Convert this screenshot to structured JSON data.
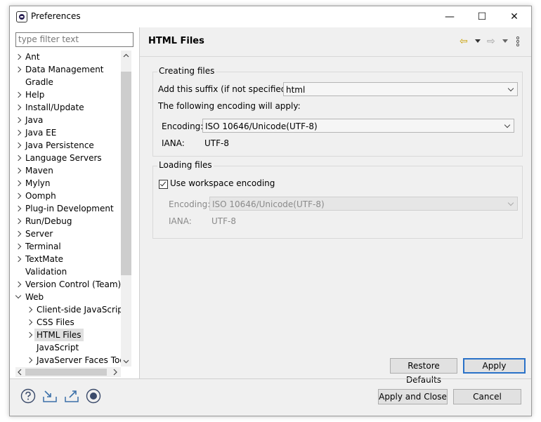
{
  "window": {
    "title": "Preferences",
    "minimize": "—",
    "maximize": "☐",
    "close": "✕"
  },
  "filter": {
    "placeholder": "type filter text"
  },
  "tree": [
    {
      "label": "Ant",
      "arrow": "right",
      "indent": 0
    },
    {
      "label": "Data Management",
      "arrow": "right",
      "indent": 0
    },
    {
      "label": "Gradle",
      "arrow": "none",
      "indent": 0
    },
    {
      "label": "Help",
      "arrow": "right",
      "indent": 0
    },
    {
      "label": "Install/Update",
      "arrow": "right",
      "indent": 0
    },
    {
      "label": "Java",
      "arrow": "right",
      "indent": 0
    },
    {
      "label": "Java EE",
      "arrow": "right",
      "indent": 0
    },
    {
      "label": "Java Persistence",
      "arrow": "right",
      "indent": 0
    },
    {
      "label": "Language Servers",
      "arrow": "right",
      "indent": 0
    },
    {
      "label": "Maven",
      "arrow": "right",
      "indent": 0
    },
    {
      "label": "Mylyn",
      "arrow": "right",
      "indent": 0
    },
    {
      "label": "Oomph",
      "arrow": "right",
      "indent": 0
    },
    {
      "label": "Plug-in Development",
      "arrow": "right",
      "indent": 0
    },
    {
      "label": "Run/Debug",
      "arrow": "right",
      "indent": 0
    },
    {
      "label": "Server",
      "arrow": "right",
      "indent": 0
    },
    {
      "label": "Terminal",
      "arrow": "right",
      "indent": 0
    },
    {
      "label": "TextMate",
      "arrow": "right",
      "indent": 0
    },
    {
      "label": "Validation",
      "arrow": "none",
      "indent": 0
    },
    {
      "label": "Version Control (Team)",
      "arrow": "right",
      "indent": 0
    },
    {
      "label": "Web",
      "arrow": "down",
      "indent": 0
    },
    {
      "label": "Client-side JavaScript",
      "arrow": "right",
      "indent": 1
    },
    {
      "label": "CSS Files",
      "arrow": "right",
      "indent": 1
    },
    {
      "label": "HTML Files",
      "arrow": "right",
      "indent": 1,
      "selected": true
    },
    {
      "label": "JavaScript",
      "arrow": "none",
      "indent": 1
    },
    {
      "label": "JavaServer Faces Tools",
      "arrow": "right",
      "indent": 1
    }
  ],
  "page": {
    "title": "HTML Files",
    "back_icon": "⇦",
    "forward_icon": "⇨",
    "creating": {
      "group_title": "Creating files",
      "suffix_label": "Add this suffix (if not specified):",
      "suffix_value": "html",
      "encoding_intro": "The following encoding will apply:",
      "encoding_label": "Encoding:",
      "encoding_value": "ISO 10646/Unicode(UTF-8)",
      "iana_label": "IANA:",
      "iana_value": "UTF-8"
    },
    "loading": {
      "group_title": "Loading files",
      "use_workspace_label": "Use workspace encoding",
      "use_workspace_checked": true,
      "encoding_label": "Encoding:",
      "encoding_value": "ISO 10646/Unicode(UTF-8)",
      "iana_label": "IANA:",
      "iana_value": "UTF-8"
    },
    "restore_defaults": "Restore Defaults",
    "apply": "Apply"
  },
  "footer": {
    "apply_and_close": "Apply and Close",
    "cancel": "Cancel"
  },
  "colors": {
    "accent": "#2a72c8",
    "selected_bg": "#e0e0e0",
    "nav_yellow": "#c9a000"
  }
}
